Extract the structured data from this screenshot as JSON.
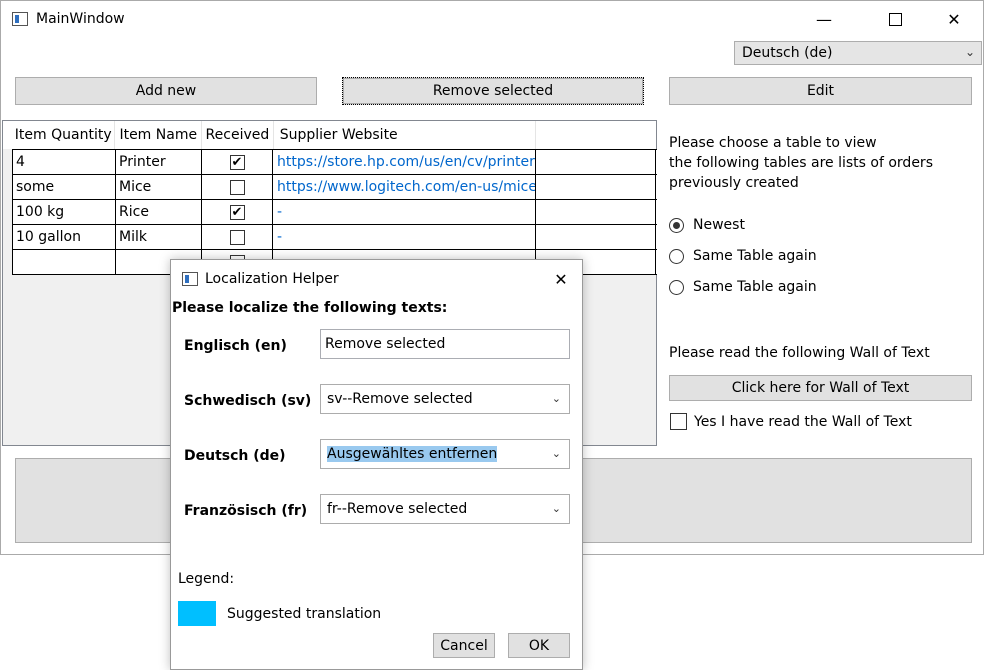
{
  "main_window": {
    "title": "MainWindow",
    "language_combo": "Deutsch (de)",
    "buttons": {
      "add_new": "Add new",
      "remove_selected": "Remove selected",
      "edit": "Edit"
    },
    "table": {
      "headers": [
        "Item Quantity",
        "Item Name",
        "Received",
        "Supplier Website"
      ],
      "rows": [
        {
          "quantity": "4",
          "name": "Printer",
          "received": true,
          "website": "https://store.hp.com/us/en/cv/printers",
          "is_link": true
        },
        {
          "quantity": "some",
          "name": "Mice",
          "received": false,
          "website": "https://www.logitech.com/en-us/mice",
          "is_link": true
        },
        {
          "quantity": "100 kg",
          "name": "Rice",
          "received": true,
          "website": "-",
          "is_link": false
        },
        {
          "quantity": "10 gallon",
          "name": "Milk",
          "received": false,
          "website": "-",
          "is_link": false
        },
        {
          "quantity": "",
          "name": "",
          "received": false,
          "website": "",
          "is_link": false
        }
      ]
    },
    "side_panel": {
      "info_lines": [
        "Please choose a table to view",
        "the following tables are lists of orders",
        "previously created"
      ],
      "radios": [
        {
          "label": "Newest",
          "checked": true
        },
        {
          "label": "Same Table again",
          "checked": false
        },
        {
          "label": "Same Table again",
          "checked": false
        }
      ],
      "wall_prompt": "Please read the following Wall of Text",
      "wall_button": "Click here for Wall of Text",
      "wall_checkbox": "Yes I have read the Wall of Text"
    }
  },
  "dialog": {
    "title": "Localization Helper",
    "heading": "Please localize the following texts:",
    "fields": [
      {
        "label": "Englisch (en)",
        "value": "Remove selected",
        "kind": "text"
      },
      {
        "label": "Schwedisch (sv)",
        "value": "sv--Remove selected",
        "kind": "dropdown"
      },
      {
        "label": "Deutsch (de)",
        "value": "Ausgewähltes entfernen",
        "kind": "dropdown",
        "highlighted": true
      },
      {
        "label": "Französisch (fr)",
        "value": "fr--Remove selected",
        "kind": "dropdown"
      }
    ],
    "legend_label": "Legend:",
    "legend_item": "Suggested translation",
    "legend_color": "#00bfff",
    "cancel": "Cancel",
    "ok": "OK"
  },
  "icons": {
    "minimize": "minimize-icon",
    "maximize": "maximize-icon",
    "close": "close-icon"
  }
}
